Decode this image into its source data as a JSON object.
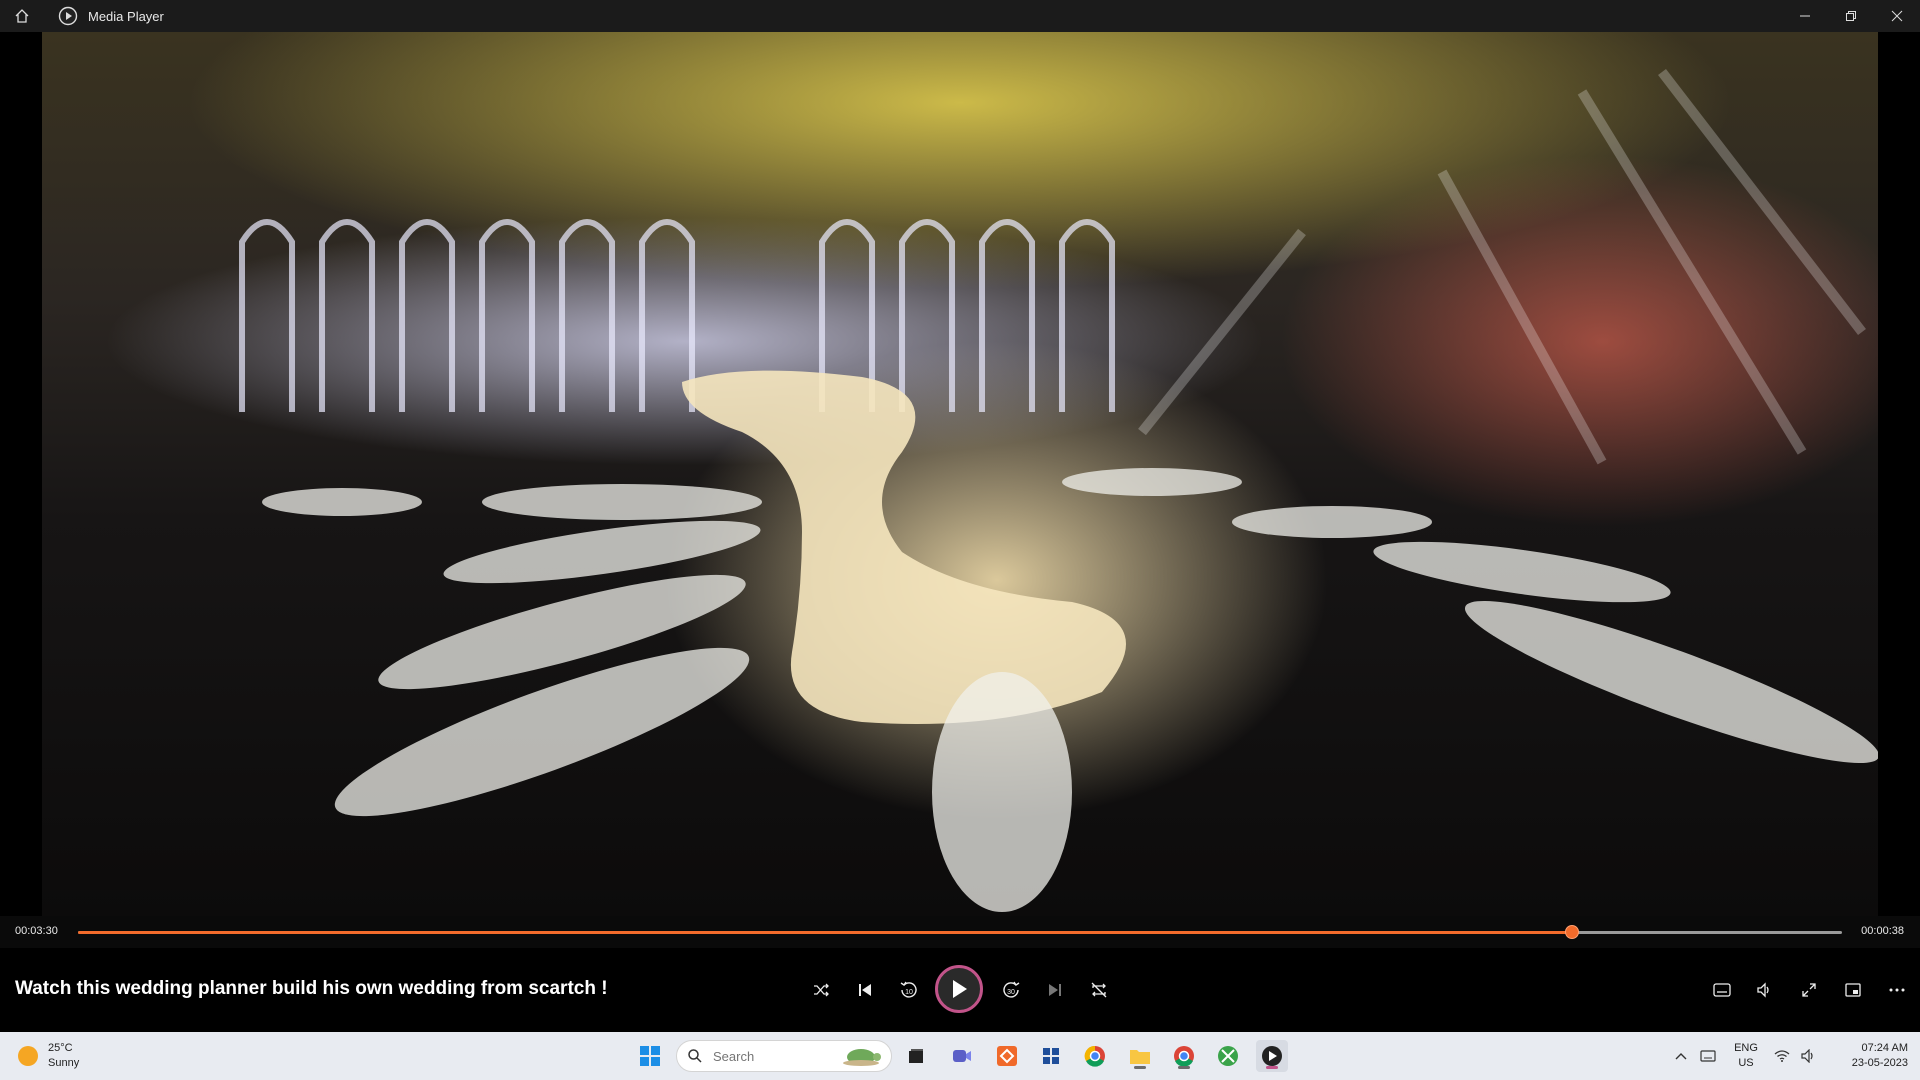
{
  "window": {
    "title": "Media Player"
  },
  "player": {
    "elapsed": "00:03:30",
    "remaining": "00:00:38",
    "progress": 0.847,
    "video_title": "Watch this wedding planner build his own wedding from scartch !",
    "accent_color": "#f26b2b",
    "controls": [
      "shuffle-icon",
      "previous-icon",
      "rewind-10-icon",
      "play-icon",
      "forward-30-icon",
      "next-icon",
      "repeat-off-icon",
      "subtitles-icon",
      "volume-icon",
      "fullscreen-icon",
      "miniplayer-icon",
      "more-icon"
    ],
    "rewind_label": "10",
    "forward_label": "30"
  },
  "taskbar": {
    "weather": {
      "temp": "25°C",
      "condition": "Sunny"
    },
    "search_placeholder": "Search",
    "apps": [
      "windows-start-icon",
      "task-view-icon",
      "teams-icon",
      "app-icon",
      "store-icon",
      "chrome-icon",
      "file-explorer-icon",
      "chrome-profile-icon",
      "xbox-icon",
      "media-player-icon"
    ],
    "lang": {
      "line1": "ENG",
      "line2": "US"
    },
    "clock": {
      "time": "07:24 AM",
      "date": "23-05-2023"
    }
  }
}
